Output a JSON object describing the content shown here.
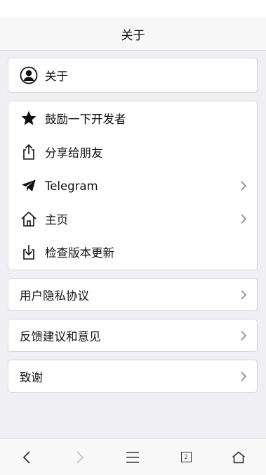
{
  "header": {
    "title": "关于"
  },
  "about_card": {
    "label": "关于",
    "icon": "user-circle-icon"
  },
  "actions": [
    {
      "label": "鼓励一下开发者",
      "icon": "star-icon",
      "chevron": false
    },
    {
      "label": "分享给朋友",
      "icon": "share-icon",
      "chevron": false
    },
    {
      "label": "Telegram",
      "icon": "telegram-icon",
      "chevron": true
    },
    {
      "label": "主页",
      "icon": "home-icon",
      "chevron": true
    },
    {
      "label": "检查版本更新",
      "icon": "download-icon",
      "chevron": false
    }
  ],
  "privacy": {
    "label": "用户隐私协议"
  },
  "feedback": {
    "label": "反馈建议和意见"
  },
  "thanks": {
    "label": "致谢"
  },
  "bottom_bar": {
    "tab_count": "2"
  }
}
